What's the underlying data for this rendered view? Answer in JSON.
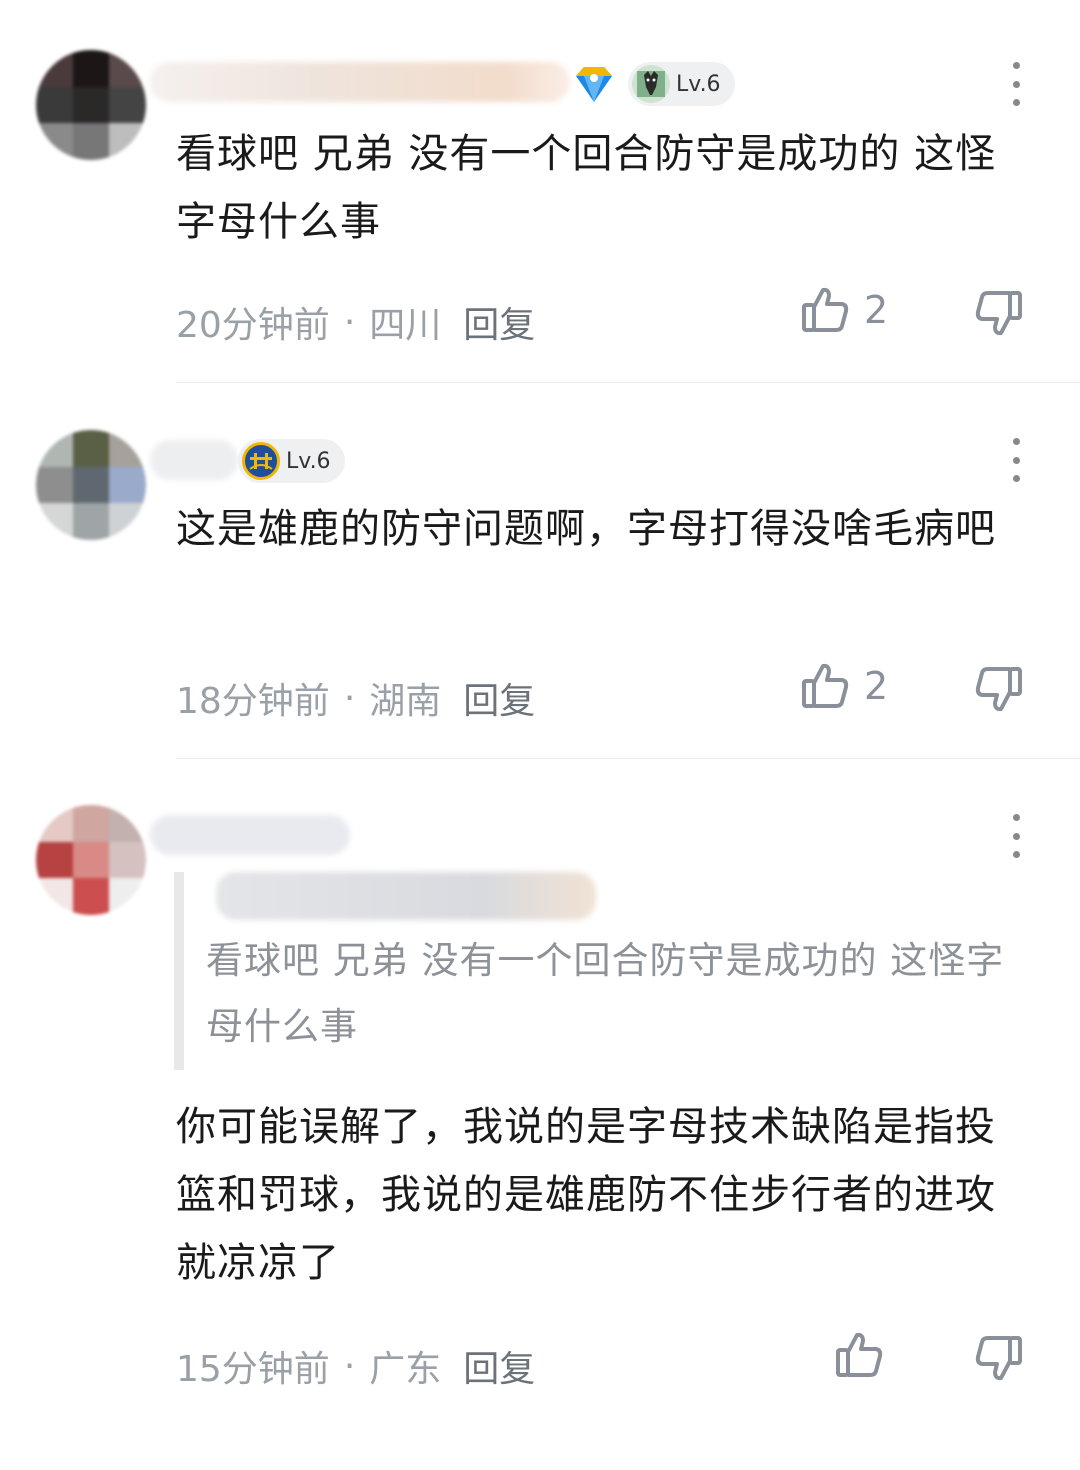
{
  "comments": [
    {
      "text": "看球吧 兄弟 没有一个回合防守是成功的 这怪字母什么事",
      "time": "20分钟前",
      "separator": "·",
      "location": "四川",
      "reply_label": "回复",
      "level": "Lv.6",
      "likes": "2"
    },
    {
      "text": "这是雄鹿的防守问题啊，字母打得没啥毛病吧",
      "time": "18分钟前",
      "separator": "·",
      "location": "湖南",
      "reply_label": "回复",
      "level": "Lv.6",
      "likes": "2"
    },
    {
      "quote": "看球吧 兄弟 没有一个回合防守是成功的 这怪字母什么事",
      "text": "你可能误解了，我说的是字母技术缺陷是指投篮和罚球，我说的是雄鹿防不住步行者的进攻就凉凉了",
      "time": "15分钟前",
      "separator": "·",
      "location": "广东",
      "reply_label": "回复"
    }
  ],
  "icons": {
    "more": "more-vertical-icon",
    "like": "thumbs-up-icon",
    "dislike": "thumbs-down-icon",
    "badge": "diamond-badge-icon",
    "level_goat": "goat-icon",
    "level_team": "warriors-logo-icon"
  },
  "colors": {
    "meta": "#9aa0a8",
    "text": "#1a1a1a",
    "quote_text": "#8d9299",
    "badge_blue": "#1e88e5",
    "badge_gold": "#f2b705"
  }
}
